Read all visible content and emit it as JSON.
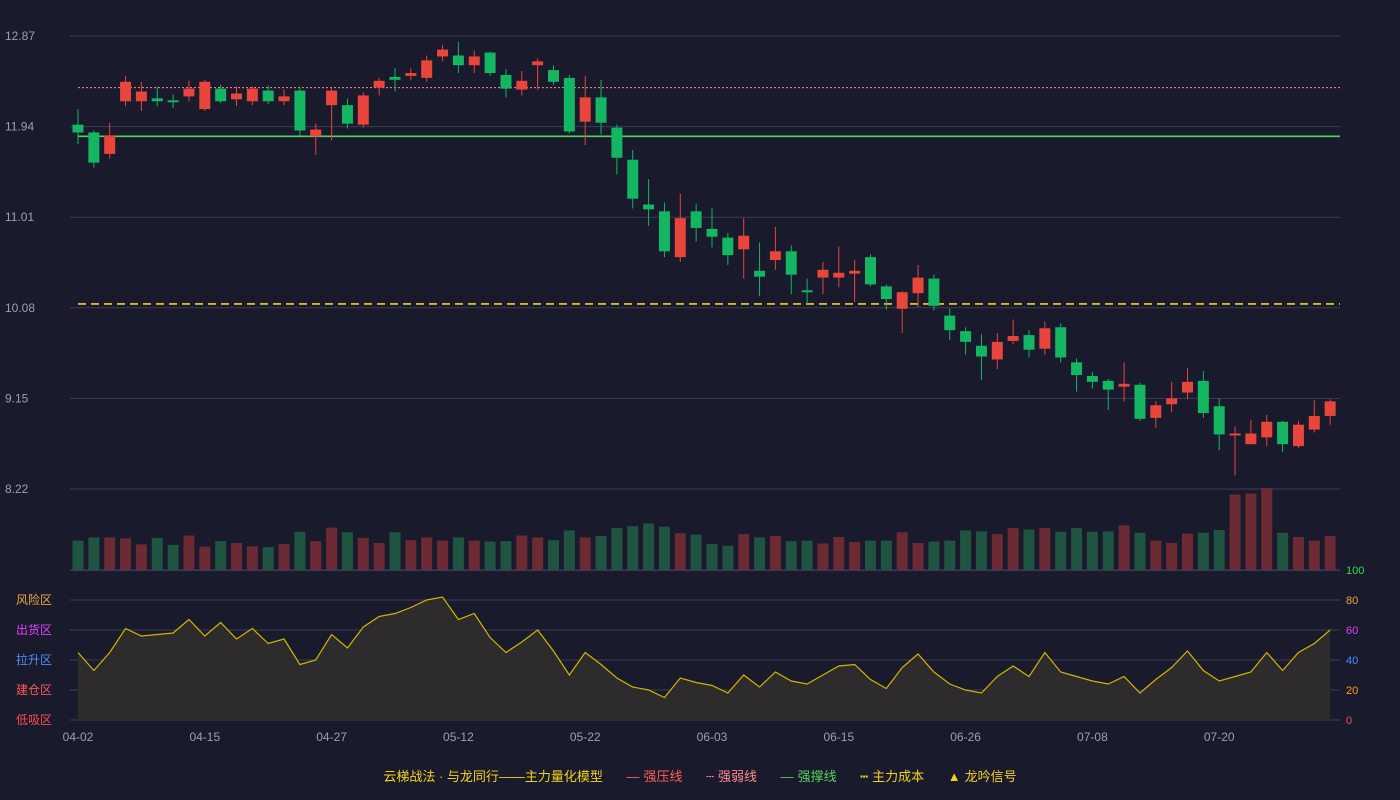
{
  "chart_data": {
    "type": "candlestick",
    "price_axis": {
      "ticks": [
        12.87,
        11.94,
        11.01,
        10.08,
        9.15,
        8.22
      ],
      "range": [
        8.22,
        12.87
      ]
    },
    "x_labels": [
      "04-02",
      "04-15",
      "04-27",
      "05-12",
      "05-22",
      "06-03",
      "06-15",
      "06-26",
      "07-08",
      "07-20"
    ],
    "x_label_index": [
      0,
      8,
      16,
      24,
      32,
      40,
      48,
      56,
      64,
      72
    ],
    "candles": [
      [
        11.96,
        11.88,
        12.12,
        11.76
      ],
      [
        11.88,
        11.57,
        11.9,
        11.52
      ],
      [
        11.66,
        11.85,
        11.98,
        11.61
      ],
      [
        12.2,
        12.4,
        12.46,
        12.15
      ],
      [
        12.2,
        12.3,
        12.4,
        12.1
      ],
      [
        12.23,
        12.2,
        12.35,
        12.15
      ],
      [
        12.21,
        12.2,
        12.27,
        12.13
      ],
      [
        12.25,
        12.33,
        12.41,
        12.2
      ],
      [
        12.12,
        12.4,
        12.42,
        12.1
      ],
      [
        12.33,
        12.2,
        12.37,
        12.18
      ],
      [
        12.22,
        12.28,
        12.35,
        12.15
      ],
      [
        12.2,
        12.33,
        12.35,
        12.16
      ],
      [
        12.31,
        12.2,
        12.36,
        12.17
      ],
      [
        12.2,
        12.25,
        12.32,
        12.16
      ],
      [
        12.31,
        11.9,
        12.35,
        11.85
      ],
      [
        11.84,
        11.91,
        11.97,
        11.65
      ],
      [
        12.16,
        12.31,
        12.34,
        11.8
      ],
      [
        12.16,
        11.97,
        12.23,
        11.92
      ],
      [
        11.96,
        12.26,
        12.29,
        11.93
      ],
      [
        12.34,
        12.41,
        12.44,
        12.26
      ],
      [
        12.45,
        12.42,
        12.54,
        12.3
      ],
      [
        12.46,
        12.49,
        12.54,
        12.42
      ],
      [
        12.44,
        12.62,
        12.67,
        12.4
      ],
      [
        12.66,
        12.73,
        12.78,
        12.61
      ],
      [
        12.67,
        12.57,
        12.81,
        12.49
      ],
      [
        12.57,
        12.66,
        12.72,
        12.49
      ],
      [
        12.7,
        12.49,
        12.71,
        12.46
      ],
      [
        12.47,
        12.33,
        12.53,
        12.24
      ],
      [
        12.32,
        12.41,
        12.51,
        12.26
      ],
      [
        12.57,
        12.61,
        12.64,
        12.32
      ],
      [
        12.52,
        12.4,
        12.57,
        12.37
      ],
      [
        12.44,
        11.89,
        12.47,
        11.87
      ],
      [
        11.99,
        12.24,
        12.46,
        11.75
      ],
      [
        12.24,
        11.98,
        12.42,
        11.86
      ],
      [
        11.93,
        11.62,
        11.96,
        11.45
      ],
      [
        11.6,
        11.2,
        11.7,
        11.1
      ],
      [
        11.14,
        11.09,
        11.4,
        10.92
      ],
      [
        11.07,
        10.66,
        11.16,
        10.6
      ],
      [
        10.6,
        11.0,
        11.25,
        10.55
      ],
      [
        11.07,
        10.9,
        11.15,
        10.76
      ],
      [
        10.89,
        10.81,
        11.1,
        10.7
      ],
      [
        10.8,
        10.62,
        10.85,
        10.52
      ],
      [
        10.68,
        10.82,
        11.0,
        10.38
      ],
      [
        10.46,
        10.4,
        10.75,
        10.2
      ],
      [
        10.57,
        10.66,
        10.91,
        10.47
      ],
      [
        10.66,
        10.42,
        10.72,
        10.22
      ],
      [
        10.26,
        10.24,
        10.38,
        10.12
      ],
      [
        10.39,
        10.47,
        10.55,
        10.22
      ],
      [
        10.39,
        10.44,
        10.71,
        10.29
      ],
      [
        10.43,
        10.46,
        10.57,
        10.14
      ],
      [
        10.6,
        10.32,
        10.63,
        10.3
      ],
      [
        10.3,
        10.17,
        10.32,
        10.06
      ],
      [
        10.07,
        10.24,
        10.25,
        9.82
      ],
      [
        10.23,
        10.39,
        10.52,
        10.09
      ],
      [
        10.38,
        10.1,
        10.42,
        10.05
      ],
      [
        10.0,
        9.85,
        10.07,
        9.75
      ],
      [
        9.84,
        9.73,
        9.88,
        9.6
      ],
      [
        9.69,
        9.58,
        9.81,
        9.34
      ],
      [
        9.55,
        9.73,
        9.82,
        9.45
      ],
      [
        9.74,
        9.79,
        9.96,
        9.71
      ],
      [
        9.8,
        9.65,
        9.85,
        9.57
      ],
      [
        9.66,
        9.87,
        9.94,
        9.6
      ],
      [
        9.88,
        9.57,
        9.92,
        9.52
      ],
      [
        9.52,
        9.39,
        9.56,
        9.22
      ],
      [
        9.38,
        9.32,
        9.42,
        9.25
      ],
      [
        9.33,
        9.24,
        9.35,
        9.03
      ],
      [
        9.27,
        9.3,
        9.52,
        9.12
      ],
      [
        9.29,
        8.94,
        9.31,
        8.92
      ],
      [
        8.95,
        9.08,
        9.12,
        8.85
      ],
      [
        9.09,
        9.15,
        9.32,
        9.01
      ],
      [
        9.21,
        9.32,
        9.46,
        9.14
      ],
      [
        9.33,
        9.0,
        9.43,
        8.95
      ],
      [
        9.07,
        8.78,
        9.15,
        8.62
      ],
      [
        8.77,
        8.79,
        8.86,
        8.36
      ],
      [
        8.68,
        8.79,
        8.93,
        8.68
      ],
      [
        8.75,
        8.91,
        8.98,
        8.66
      ],
      [
        8.91,
        8.68,
        8.92,
        8.6
      ],
      [
        8.66,
        8.88,
        8.92,
        8.64
      ],
      [
        8.83,
        8.97,
        9.13,
        8.8
      ],
      [
        8.97,
        9.12,
        9.14,
        8.88
      ]
    ],
    "volume": [
      63,
      70,
      70,
      68,
      55,
      69,
      54,
      74,
      50,
      62,
      58,
      51,
      49,
      56,
      82,
      62,
      91,
      81,
      69,
      58,
      81,
      64,
      70,
      63,
      70,
      63,
      61,
      62,
      74,
      70,
      64,
      85,
      70,
      73,
      90,
      94,
      100,
      93,
      79,
      76,
      56,
      52,
      77,
      70,
      73,
      62,
      63,
      57,
      71,
      60,
      63,
      63,
      81,
      58,
      61,
      63,
      85,
      83,
      77,
      90,
      87,
      90,
      82,
      90,
      82,
      83,
      96,
      80,
      63,
      58,
      78,
      80,
      86,
      162,
      164,
      176,
      80,
      71,
      63,
      73
    ],
    "indicator": [
      45,
      33,
      45,
      61,
      56,
      57,
      58,
      67,
      56,
      65,
      54,
      61,
      51,
      54,
      37,
      40,
      57,
      48,
      62,
      69,
      71,
      75,
      80,
      82,
      67,
      71,
      55,
      45,
      52,
      60,
      46,
      30,
      45,
      37,
      28,
      22,
      20,
      15,
      28,
      25,
      23,
      18,
      30,
      22,
      32,
      26,
      24,
      30,
      36,
      37,
      27,
      21,
      35,
      44,
      32,
      24,
      20,
      18,
      29,
      36,
      29,
      45,
      32,
      29,
      26,
      24,
      29,
      18,
      27,
      35,
      46,
      33,
      26,
      29,
      32,
      45,
      33,
      45,
      51,
      60
    ],
    "indicator_axis": {
      "ticks": [
        100,
        80,
        60,
        40,
        20,
        0
      ],
      "range": [
        0,
        100
      ]
    },
    "zones": [
      "风险区",
      "出货区",
      "拉升区",
      "建仓区",
      "低吸区"
    ],
    "lines": {
      "strong_pressure": 12.34,
      "strong_support": 11.84,
      "main_cost": 10.12
    },
    "colors": {
      "up": "#e8453c",
      "down": "#14b563",
      "vol_up": "#6b2a34",
      "vol_down": "#1e5440",
      "pressure": "#ff5e57",
      "weak": "#ff8c8c",
      "support": "#54d35c",
      "cost": "#f2d21f",
      "indicator": "#d1b400",
      "zone_colors": [
        "#e8a93c",
        "#e040fb",
        "#4b8cff",
        "#ff5757",
        "#ff4d4d"
      ],
      "right_tick_colors": [
        "#36d84a",
        "#e8a93c",
        "#e040fb",
        "#4b8cff",
        "#ff9f1c",
        "#ff4d4d"
      ]
    }
  },
  "legend": {
    "title": "云梯战法 · 与龙同行——主力量化模型",
    "items": [
      {
        "symbol": "—",
        "label": "强压线",
        "color": "#ff5e57"
      },
      {
        "symbol": "- - -",
        "label": "强弱线",
        "color": "#ff8c8c"
      },
      {
        "symbol": "—",
        "label": "强撑线",
        "color": "#54d35c"
      },
      {
        "symbol": "- - -",
        "label": "主力成本",
        "color": "#f2d21f"
      },
      {
        "symbol": "▲",
        "label": "龙吟信号",
        "color": "#f2d21f"
      }
    ],
    "title_color": "#f2d21f"
  }
}
